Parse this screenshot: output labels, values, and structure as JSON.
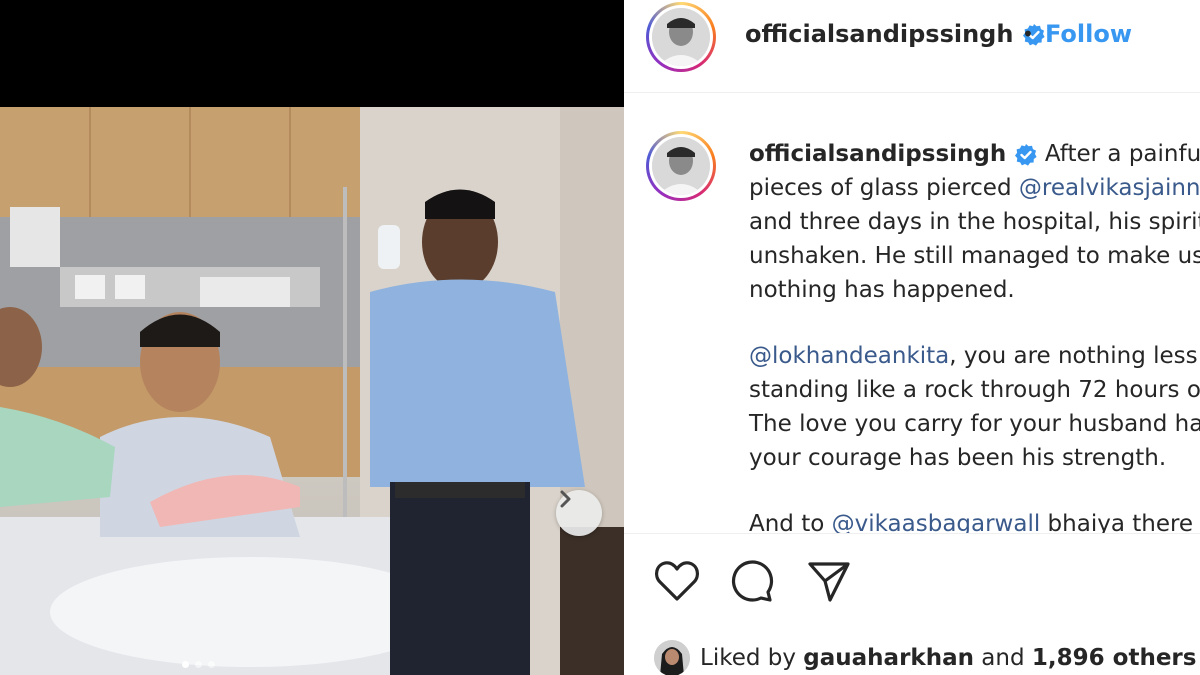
{
  "post": {
    "username": "officialsandipssingh",
    "follow_label": "Follow",
    "separator": "•"
  },
  "caption": {
    "username": "officialsandipssingh",
    "lines": [
      "After a painful a",
      "pieces of glass pierced ",
      "@realvikasjainn",
      "and three days in the hospital, his spirit",
      "unshaken. He still managed to make us",
      "nothing has happened.",
      "@lokhandeankita",
      ", you are nothing less",
      "standing like a rock through 72 hours o",
      "The love you carry for your husband ha",
      "your courage has been his strength.",
      "And to ",
      "@vikaasbagarwall",
      " bhaiya there"
    ]
  },
  "actions": {
    "like": "heart-icon",
    "comment": "comment-icon",
    "share": "share-icon"
  },
  "likes": {
    "prefix": "Liked by ",
    "user": "gauaharkhan",
    "middle": " and ",
    "count": "1,896 others"
  },
  "colors": {
    "follow": "#3897f0",
    "verified": "#3897f0",
    "mention": "#3a5a8c"
  }
}
